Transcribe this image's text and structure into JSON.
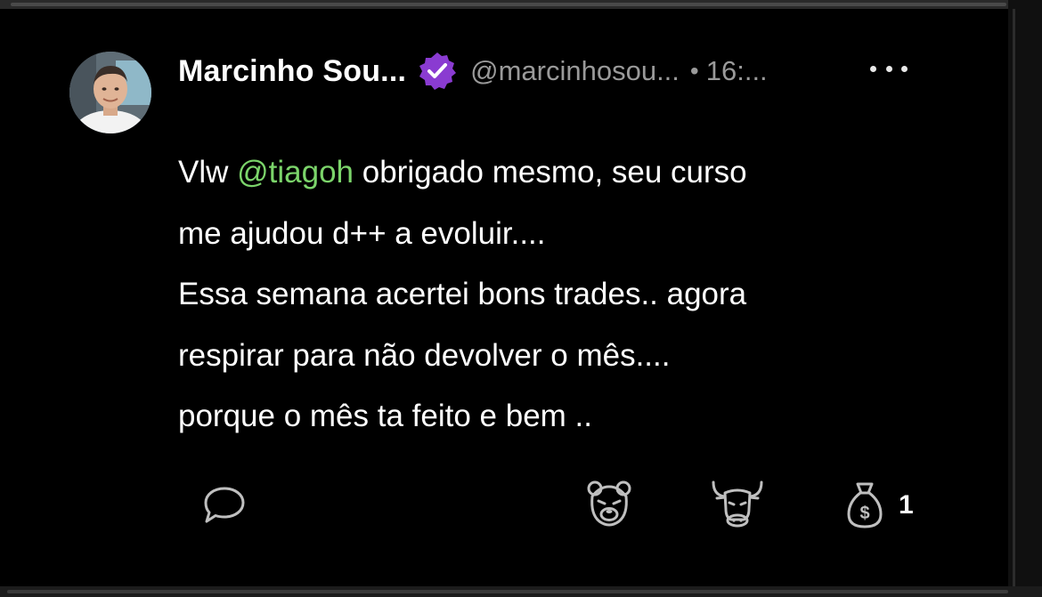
{
  "post": {
    "author": {
      "name": "Marcinho Sou...",
      "handle": "@marcinhosou...",
      "separator": "•",
      "time": "16:...",
      "verified": true
    },
    "text": {
      "line1_prefix": "Vlw ",
      "mention": "@tiagoh",
      "line1_suffix": " obrigado mesmo, seu curso",
      "line2": "me ajudou d++ a evoluir....",
      "line3": "Essa semana acertei bons trades.. agora",
      "line4": "respirar para não devolver o mês....",
      "line5": "porque o mês ta feito e bem .."
    },
    "actions": {
      "reply_icon": "speech-bubble-icon",
      "bear_icon": "bear-icon",
      "bull_icon": "bull-icon",
      "tip_icon": "money-bag-icon",
      "tip_count": "1"
    },
    "colors": {
      "background": "#000000",
      "text": "#ffffff",
      "muted": "#9a9a9a",
      "mention": "#7bd46a",
      "verified_badge": "#8a3bd1"
    }
  }
}
